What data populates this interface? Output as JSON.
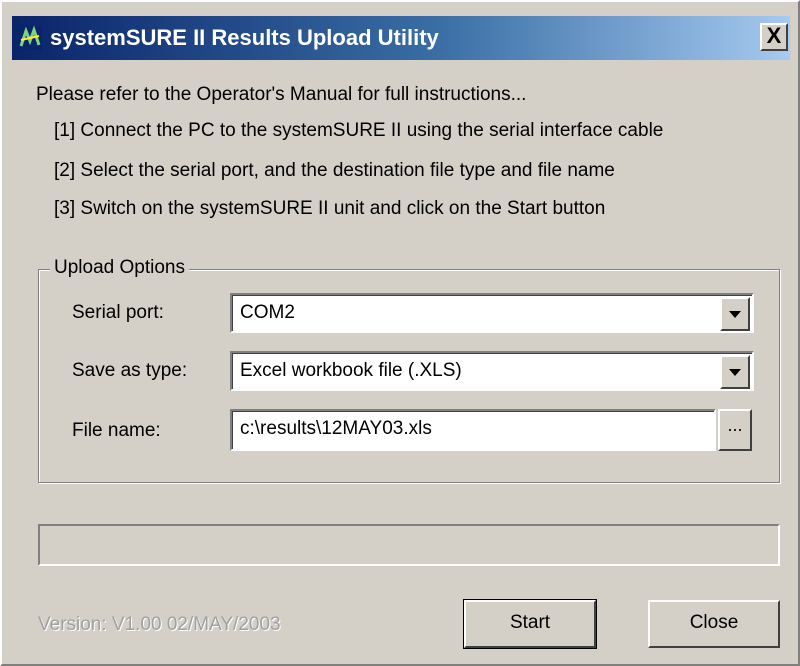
{
  "window": {
    "title": "systemSURE II Results Upload Utility",
    "close_label": "X"
  },
  "instructions": {
    "intro": "Please refer to the Operator's Manual for full instructions...",
    "steps": [
      "[1]  Connect the PC to the systemSURE II using the serial interface cable",
      "[2]  Select the serial port, and the destination file type and file name",
      "[3]  Switch on the systemSURE II unit and click on the Start button"
    ]
  },
  "upload_options": {
    "legend": "Upload Options",
    "serial_port": {
      "label": "Serial port:",
      "value": "COM2"
    },
    "save_as_type": {
      "label": "Save as type:",
      "value": "Excel workbook file (.XLS)"
    },
    "file_name": {
      "label": "File name:",
      "value": "c:\\results\\12MAY03.xls",
      "browse_label": "..."
    }
  },
  "progress": {
    "value": 0
  },
  "footer": {
    "version": "Version: V1.00 02/MAY/2003",
    "start_label": "Start",
    "close_label": "Close"
  },
  "icons": {
    "app": "app-logo-icon",
    "dropdown": "chevron-down-icon"
  },
  "colors": {
    "title_start": "#0a246a",
    "title_end": "#a6caf0",
    "face": "#d4d0c8"
  }
}
